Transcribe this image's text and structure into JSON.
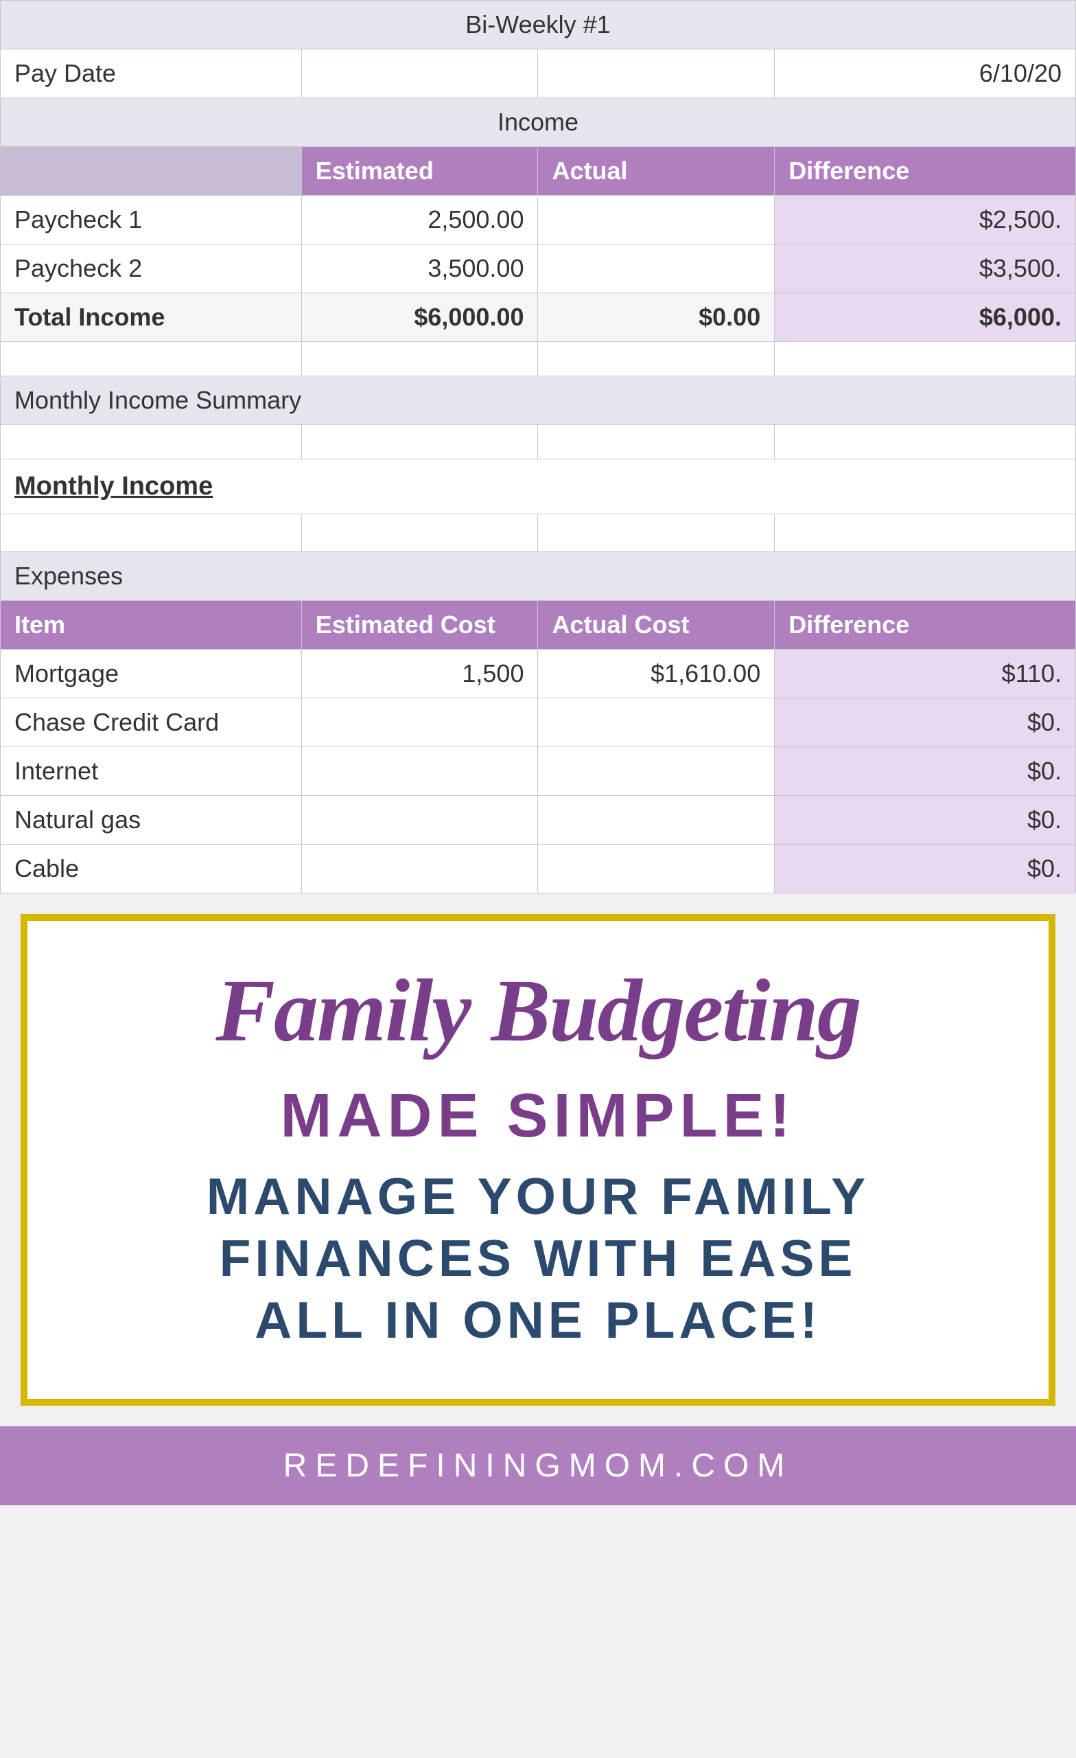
{
  "spreadsheet": {
    "biweekly_label": "Bi-Weekly #1",
    "paydate_label": "Pay Date",
    "paydate_value": "6/10/20",
    "income_section_label": "Income",
    "col_headers": {
      "blank": "",
      "estimated": "Estimated",
      "actual": "Actual",
      "difference": "Difference"
    },
    "income_rows": [
      {
        "label": "Paycheck 1",
        "estimated": "2,500.00",
        "actual": "",
        "difference": "$2,500."
      },
      {
        "label": "Paycheck 2",
        "estimated": "3,500.00",
        "actual": "",
        "difference": "$3,500."
      }
    ],
    "total_income": {
      "label": "Total Income",
      "estimated": "$6,000.00",
      "actual": "$0.00",
      "difference": "$6,000."
    },
    "monthly_summary_label": "Monthly Income Summary",
    "monthly_income_label": "Monthly Income",
    "expenses_section_label": "Expenses",
    "expenses_col_headers": {
      "item": "Item",
      "estimated_cost": "Estimated Cost",
      "actual_cost": "Actual Cost",
      "difference": "Difference"
    },
    "expense_rows": [
      {
        "item": "Mortgage",
        "estimated_cost": "1,500",
        "actual_cost": "$1,610.00",
        "difference": "$110."
      },
      {
        "item": "Chase Credit Card",
        "estimated_cost": "",
        "actual_cost": "",
        "difference": "$0."
      },
      {
        "item": "Internet",
        "estimated_cost": "",
        "actual_cost": "",
        "difference": "$0."
      },
      {
        "item": "Natural gas",
        "estimated_cost": "",
        "actual_cost": "",
        "difference": "$0."
      },
      {
        "item": "Cable",
        "estimated_cost": "",
        "actual_cost": "",
        "difference": "$0."
      }
    ]
  },
  "promo": {
    "title_line1": "Family Budgeting",
    "subtitle": "MADE SIMPLE!",
    "body_line1": "MANAGE YOUR FAMILY",
    "body_line2": "FINANCES WITH EASE",
    "body_line3": "ALL IN ONE PLACE!"
  },
  "footer": {
    "text": "REDEFININGMOM.COM"
  }
}
